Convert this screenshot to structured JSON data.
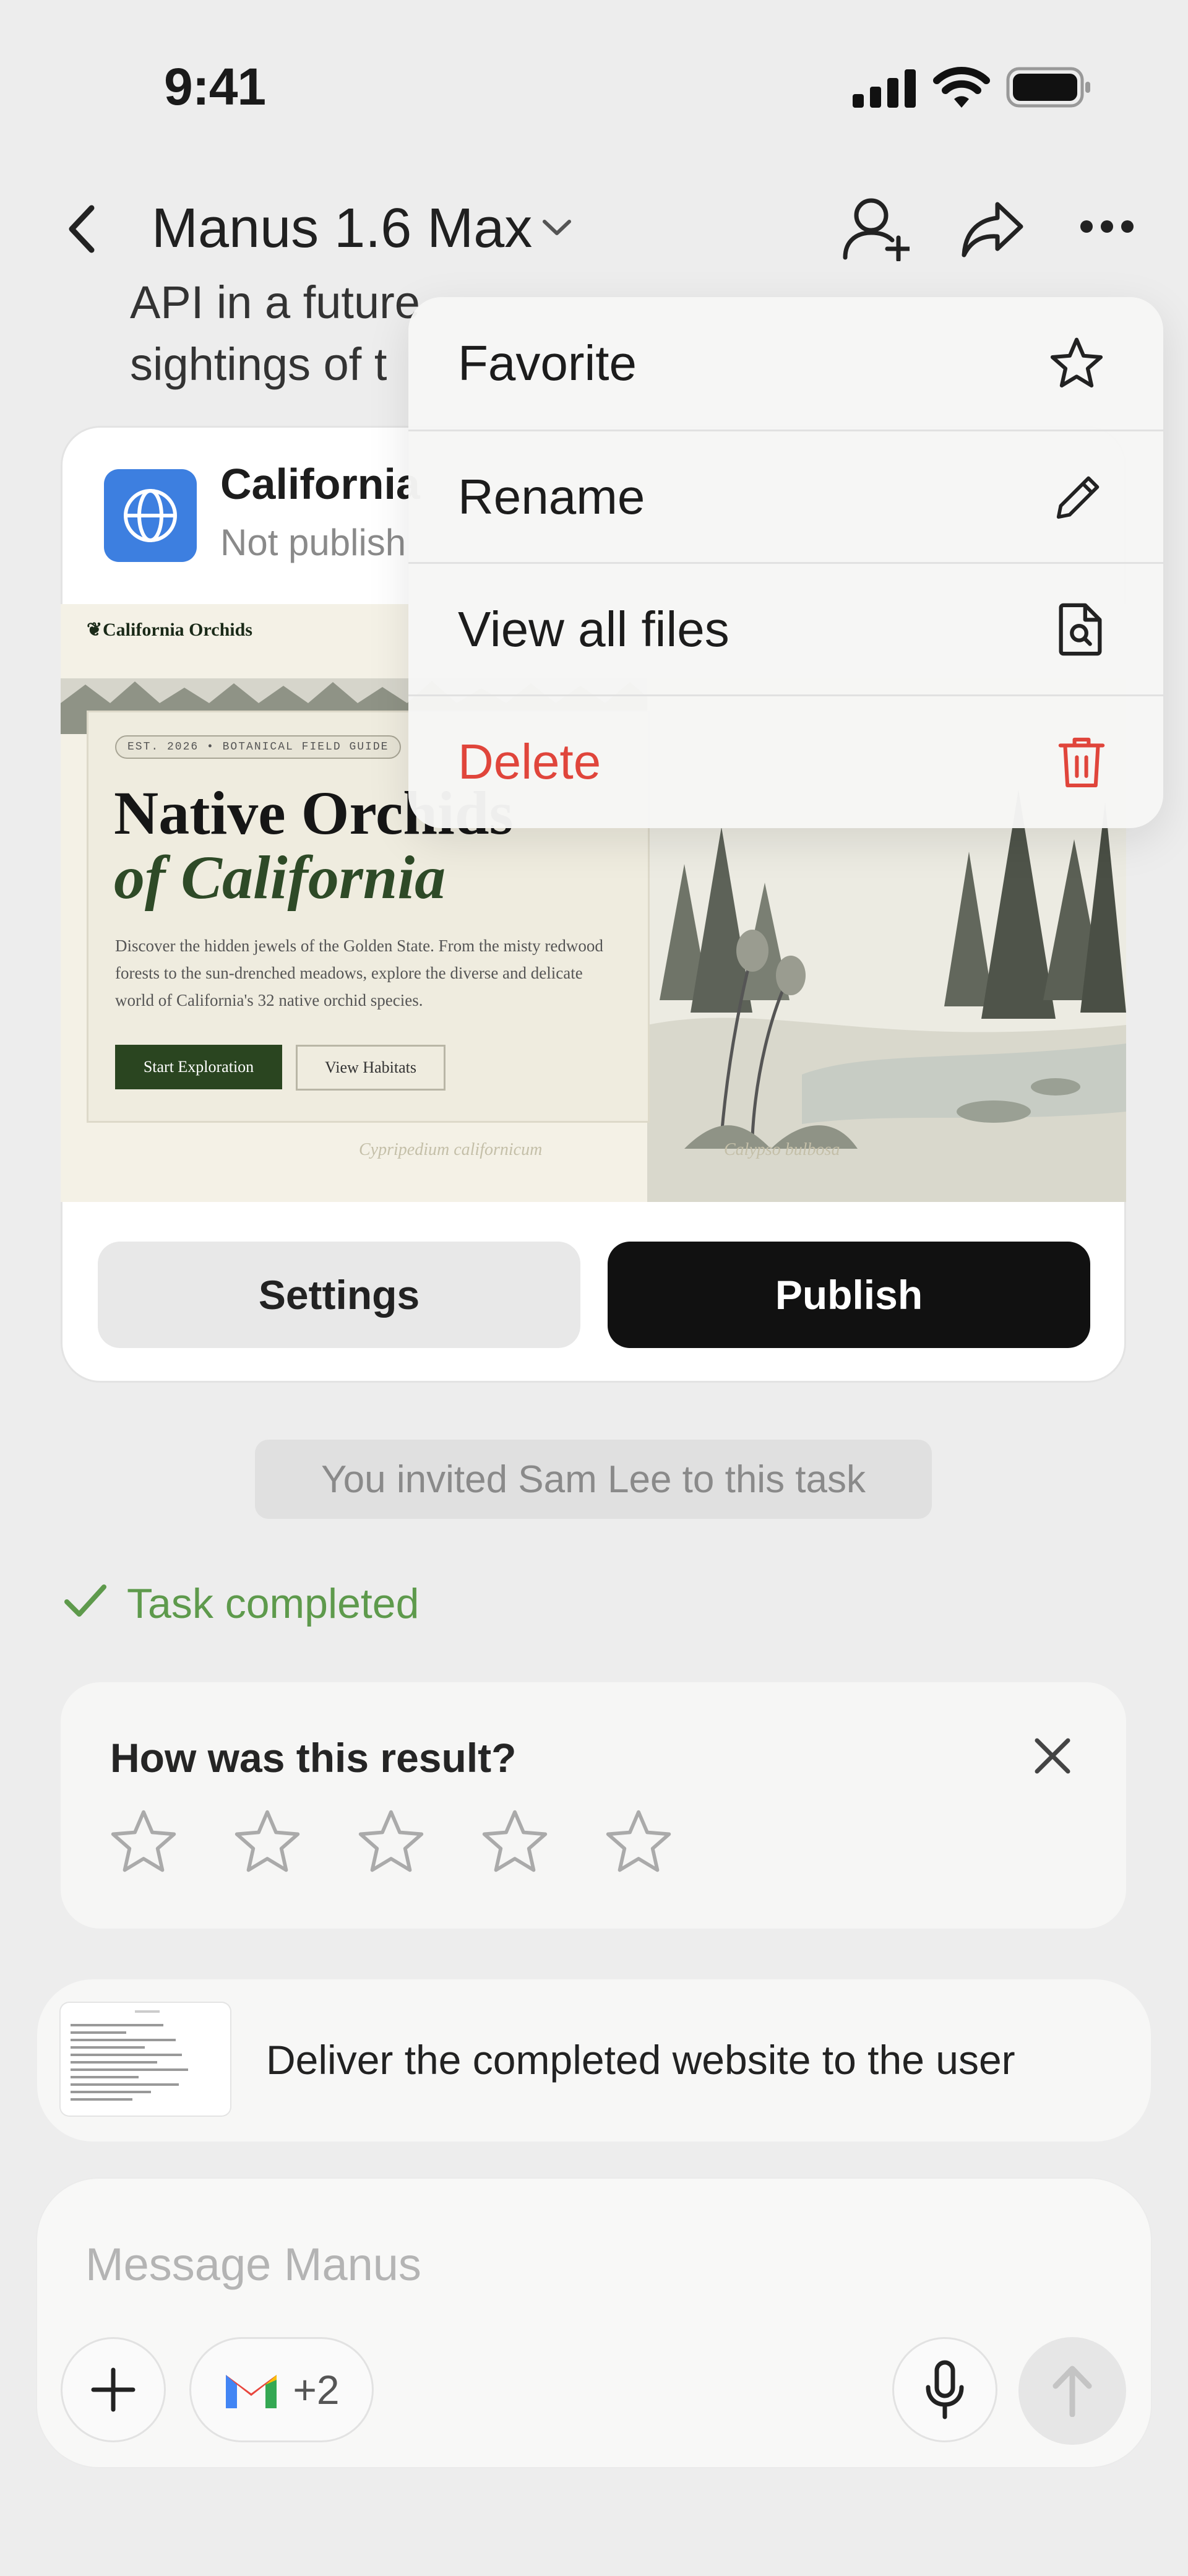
{
  "status_bar": {
    "time": "9:41"
  },
  "header": {
    "title": "Manus 1.6 Max"
  },
  "background_text": {
    "line1": "API in a future ",
    "line2": "sightings of t"
  },
  "website_card": {
    "title": "California",
    "status": "Not publish",
    "preview": {
      "brand": "California Orchids",
      "badge": "EST. 2026 • BOTANICAL FIELD GUIDE",
      "heading_line1": "Native Orchids",
      "heading_line2": "of California",
      "description": "Discover the hidden jewels of the Golden State. From the misty redwood forests to the sun-drenched meadows, explore the diverse and delicate world of California's 32 native orchid species.",
      "primary_button": "Start Exploration",
      "secondary_button": "View Habitats",
      "caption_left": "Cypripedium californicum",
      "caption_right": "Calypso bulbosa"
    },
    "settings_label": "Settings",
    "publish_label": "Publish"
  },
  "invite_notice": "You invited Sam Lee to this task",
  "task_status": "Task completed",
  "rating": {
    "question": "How was this result?",
    "stars_total": 5,
    "stars_selected": 0
  },
  "task_item": {
    "text": "Deliver the completed website to the user"
  },
  "composer": {
    "placeholder": "Message Manus",
    "connector_extra": "+2"
  },
  "menu": {
    "items": [
      {
        "label": "Favorite",
        "icon": "star-icon"
      },
      {
        "label": "Rename",
        "icon": "pencil-icon"
      },
      {
        "label": "View all files",
        "icon": "file-search-icon"
      },
      {
        "label": "Delete",
        "icon": "trash-icon"
      }
    ]
  },
  "colors": {
    "background": "#ededed",
    "success": "#5e9a4c",
    "danger": "#e0453b",
    "primary_button": "#111111",
    "site_icon": "#3d7fe0"
  }
}
